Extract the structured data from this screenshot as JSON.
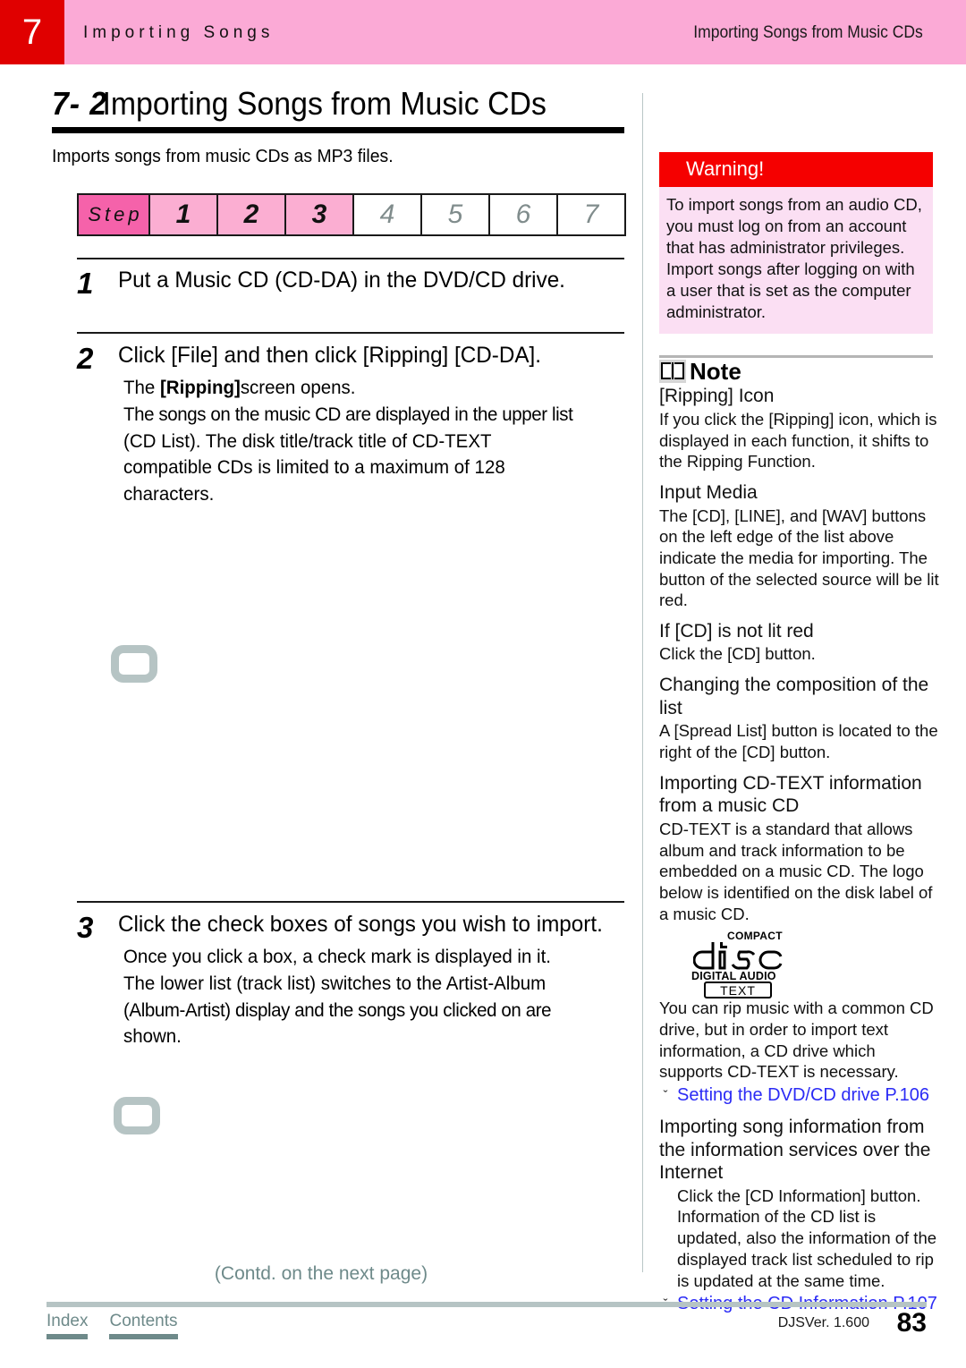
{
  "header": {
    "chapter_number": "7",
    "chapter_title": "Importing Songs",
    "section_title": "Importing Songs from Music CDs",
    "tab_color": "#e00000",
    "band_color": "#fbaad6"
  },
  "title": {
    "number": "7- 2",
    "text": "Importing Songs from Music CDs"
  },
  "intro": "Imports songs from music CDs as MP3 files.",
  "stepbar": {
    "label": "Step",
    "cells": [
      {
        "num": "1",
        "active": true
      },
      {
        "num": "2",
        "active": true
      },
      {
        "num": "3",
        "active": true
      },
      {
        "num": "4",
        "active": false
      },
      {
        "num": "5",
        "active": false
      },
      {
        "num": "6",
        "active": false
      },
      {
        "num": "7",
        "active": false
      }
    ],
    "active_color": "#fbaed2",
    "label_color": "#f562aa"
  },
  "steps": [
    {
      "num": "1",
      "heading": "Put a Music CD (CD-DA) in the DVD/CD drive.",
      "body": []
    },
    {
      "num": "2",
      "heading": "Click [File] and then click [Ripping]   [CD-DA].",
      "body_pre": "The ",
      "body_bold": "[Ripping]",
      "body_post": "screen opens.",
      "body": [
        "The songs on the music CD are displayed in the upper list",
        "(CD List). The disk title/track title of CD-TEXT",
        "compatible CDs is limited to a maximum of 128",
        "characters."
      ]
    },
    {
      "num": "3",
      "heading": "Click the check boxes of songs you wish to import.",
      "body": [
        "Once you click a box, a check mark is displayed in it.",
        "The lower list (track list) switches to the Artist-Album",
        "(Album-Artist) display and the songs you clicked on are",
        "shown."
      ]
    }
  ],
  "warning": {
    "heading": "Warning!",
    "text": "To import songs from an audio CD, you must log on from an account that has administrator privileges. Import songs after logging on with a user that is set as the computer administrator.",
    "head_bg": "#f50000",
    "body_bg": "#fbdff3"
  },
  "note": {
    "title": "Note",
    "sections": [
      {
        "sub": "[Ripping] Icon",
        "text": "If you click the [Ripping] icon, which is displayed in each function, it shifts to the Ripping Function."
      },
      {
        "sub": "Input Media",
        "text": "The [CD], [LINE], and [WAV] buttons on the left edge of the list above indicate the media for importing. The button of the selected source will be lit red."
      },
      {
        "sub": "If [CD] is not lit red",
        "text": "Click the [CD] button."
      },
      {
        "sub": "Changing the composition of the list",
        "text": "A [Spread List] button is located to the right of the [CD] button."
      },
      {
        "sub": "Importing CD-TEXT information from a music CD",
        "text": "CD-TEXT is a standard that allows album and track information to be embedded on a music CD. The logo below is identified on the disk label of a music CD."
      }
    ],
    "cd_logo": {
      "compact": "COMPACT",
      "disc": "disc",
      "digital_audio": "DIGITAL AUDIO",
      "text": "TEXT"
    },
    "cdtext_after_logo": "You can rip music with a common CD drive, but in order to import text information, a CD drive which supports CD-TEXT is necessary.",
    "link_1": "Setting the DVD/CD drive  P.106",
    "internet_sub": "Importing song information from the information services over the Internet",
    "internet_text": "Click the [CD Information] button. Information of the CD list is updated, also the information of the displayed track list scheduled to rip is updated at the same time.",
    "link_2": "Setting the CD Information  P.107",
    "link_color": "#2b2bf5"
  },
  "footer": {
    "contd": "(Contd. on the next page)",
    "index_label": "Index",
    "contents_label": "Contents",
    "version": "DJSVer. 1.600",
    "page_number": "83"
  }
}
